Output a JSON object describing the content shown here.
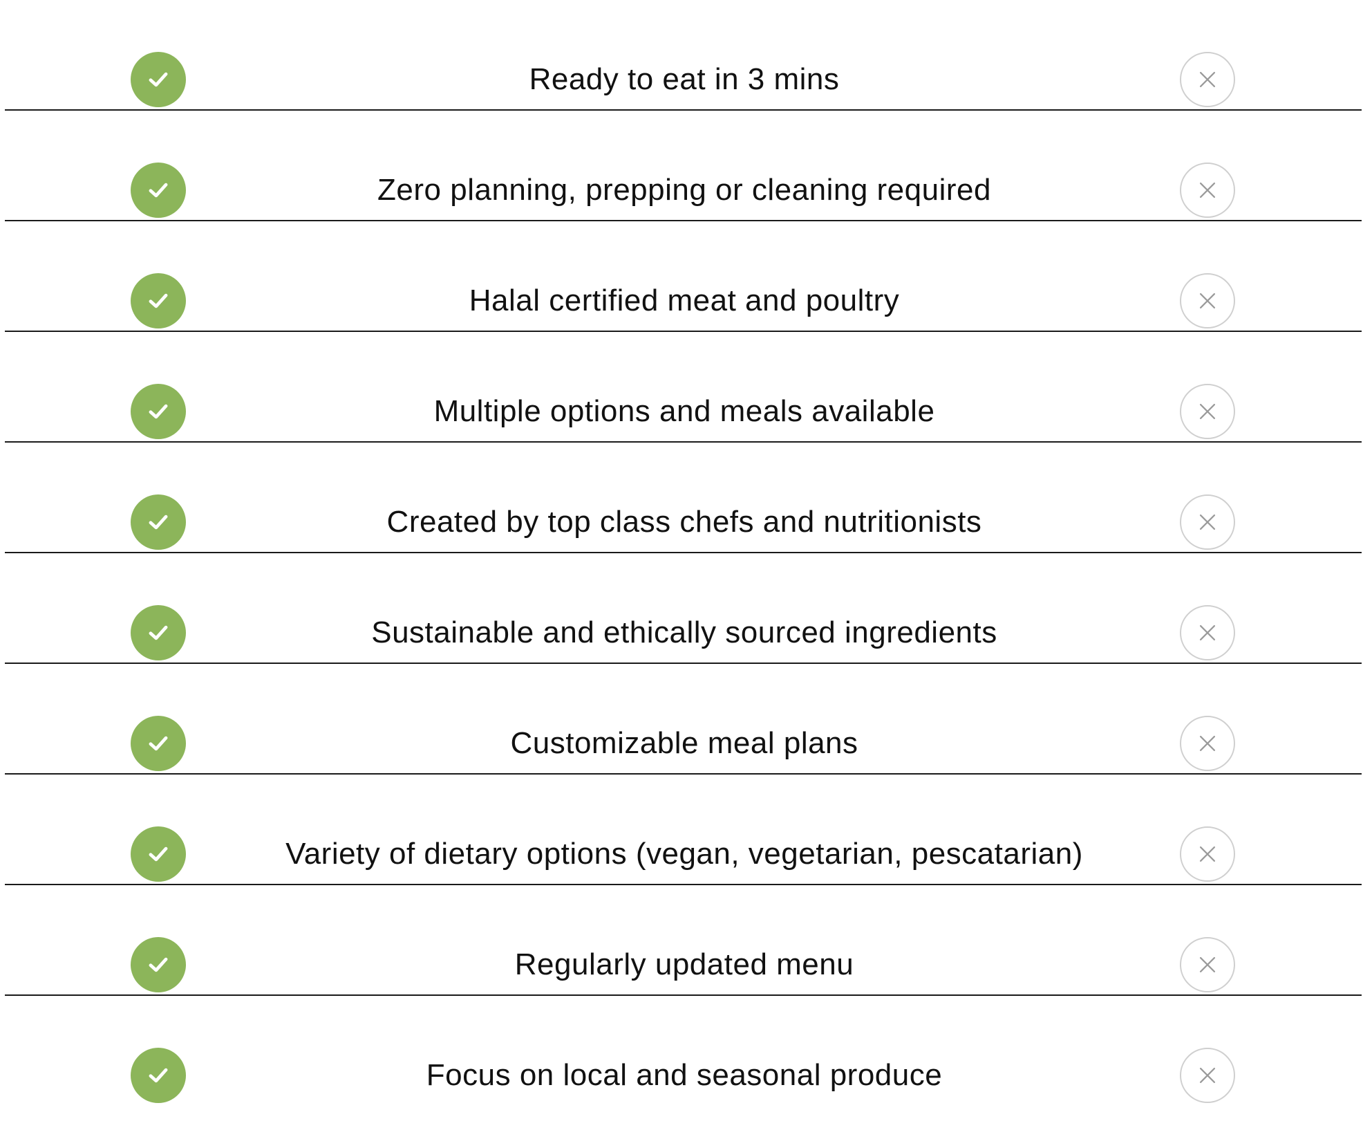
{
  "comparison": {
    "rows": [
      {
        "feature": "Ready to eat in 3 mins"
      },
      {
        "feature": "Zero planning, prepping or cleaning required"
      },
      {
        "feature": "Halal certified meat and poultry"
      },
      {
        "feature": "Multiple options and meals available"
      },
      {
        "feature": "Created by top class chefs and nutritionists"
      },
      {
        "feature": "Sustainable and ethically sourced ingredients"
      },
      {
        "feature": "Customizable meal plans"
      },
      {
        "feature": "Variety of dietary options (vegan, vegetarian, pescatarian)"
      },
      {
        "feature": "Regularly updated menu"
      },
      {
        "feature": "Focus on local and seasonal produce"
      }
    ],
    "icons": {
      "included": "check-icon",
      "excluded": "close-icon"
    },
    "colors": {
      "included_bg": "#8cb55a",
      "excluded_border": "#cfcfcf",
      "divider": "#1a1a1a",
      "text": "#111111"
    }
  }
}
